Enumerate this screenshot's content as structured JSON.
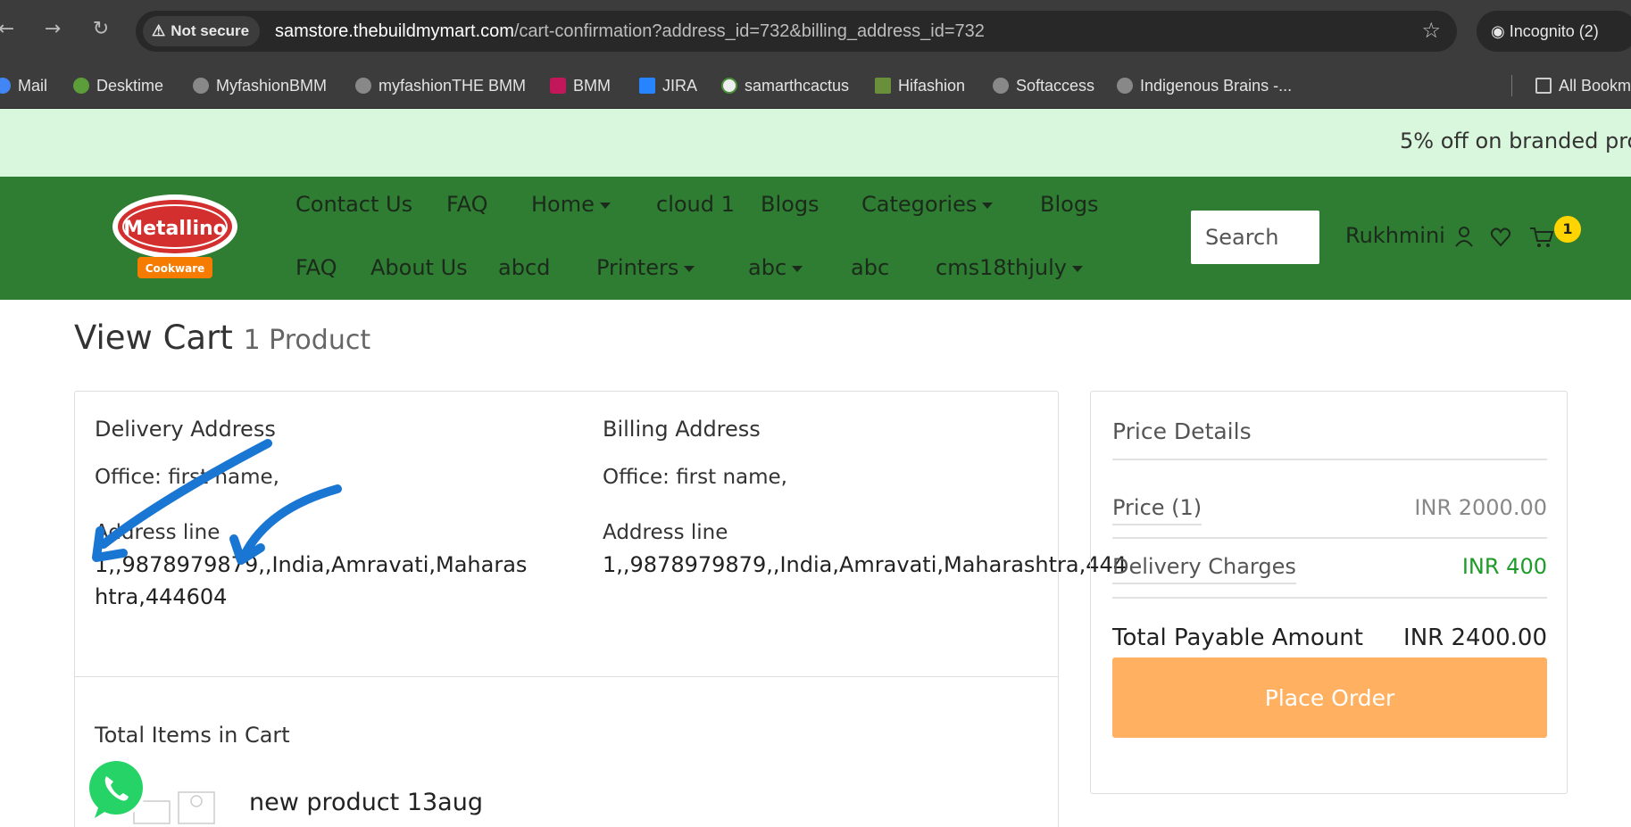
{
  "browser": {
    "security_label": "Not secure",
    "url_host": "samstore.thebuildmymart.com",
    "url_path": "/cart-confirmation?address_id=732&billing_address_id=732",
    "incognito_label": "Incognito (2)"
  },
  "bookmarks": [
    {
      "label": "Mail"
    },
    {
      "label": "Desktime"
    },
    {
      "label": "MyfashionBMM"
    },
    {
      "label": "myfashionTHE BMM"
    },
    {
      "label": "BMM"
    },
    {
      "label": "JIRA"
    },
    {
      "label": "samarthcactus"
    },
    {
      "label": "Hifashion"
    },
    {
      "label": "Softaccess"
    },
    {
      "label": "Indigenous Brains -..."
    },
    {
      "label": "All Bookm"
    }
  ],
  "promo": {
    "text": "5% off on branded pro"
  },
  "logo": {
    "brand": "Metallino",
    "sub": "Cookware"
  },
  "nav": {
    "row1": [
      "Contact Us",
      "FAQ",
      "Home",
      "cloud 1",
      "Blogs",
      "Categories",
      "Blogs"
    ],
    "row2": [
      "FAQ",
      "About Us",
      "abcd",
      "Printers",
      "abc",
      "abc",
      "cms18thjuly"
    ]
  },
  "header": {
    "search_placeholder": "Search",
    "user_name": "Rukhmini",
    "cart_count": "1"
  },
  "page": {
    "title": "View Cart",
    "product_count": "1 Product"
  },
  "delivery": {
    "heading": "Delivery Address",
    "office": "Office: first name,",
    "address_label": "Address line",
    "address_value": "1,,9878979879,,India,Amravati,Maharashtra,444604"
  },
  "billing": {
    "heading": "Billing Address",
    "office": "Office: first name,",
    "address_label": "Address line",
    "address_value": "1,,9878979879,,India,Amravati,Maharashtra,444"
  },
  "price": {
    "title": "Price Details",
    "price_label": "Price  (1)",
    "price_value": "INR 2000.00",
    "delivery_label": "Delivery Charges",
    "delivery_value": "INR 400",
    "total_label": "Total Payable Amount",
    "total_value": "INR  2400.00",
    "place_order": "Place Order"
  },
  "items": {
    "title": "Total Items in Cart",
    "product_name": "new product 13aug"
  },
  "colors": {
    "header_green": "#2e7d32",
    "promo_bg": "#d9f7dc",
    "place_order": "#ffb060",
    "delivery_green": "#1e9b28",
    "arrow_blue": "#1976d2"
  }
}
